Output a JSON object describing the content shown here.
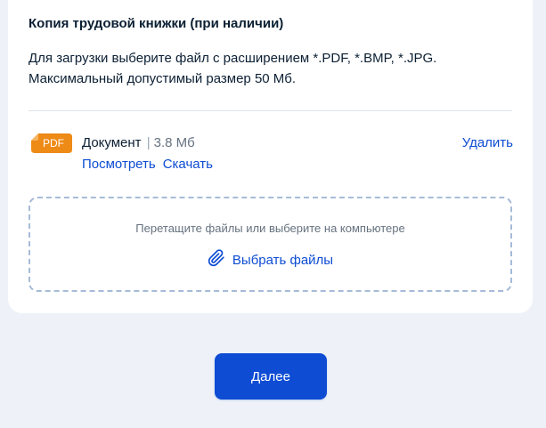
{
  "section": {
    "title": "Копия трудовой книжки (при наличии)",
    "description_line1": "Для загрузки выберите файл с расширением *.PDF, *.BMP, *.JPG.",
    "description_line2": "Максимальный допустимый размер 50 Мб."
  },
  "file": {
    "badge": "PDF",
    "badge_color": "#ee8a16",
    "icon": "pdf-file-icon",
    "name": "Документ",
    "separator": "|",
    "size": "3.8 Мб",
    "view_label": "Посмотреть",
    "download_label": "Скачать",
    "delete_label": "Удалить"
  },
  "dropzone": {
    "hint": "Перетащите файлы или выберите на компьютере",
    "choose_label": "Выбрать файлы",
    "icon": "paperclip-icon"
  },
  "footer": {
    "next_label": "Далее"
  },
  "colors": {
    "accent": "#0d4cd3",
    "page_background": "#eef2f8",
    "card_background": "#ffffff",
    "text": "#0b1f33",
    "muted_text": "#66727f",
    "dropzone_border": "#a7bbd8"
  }
}
